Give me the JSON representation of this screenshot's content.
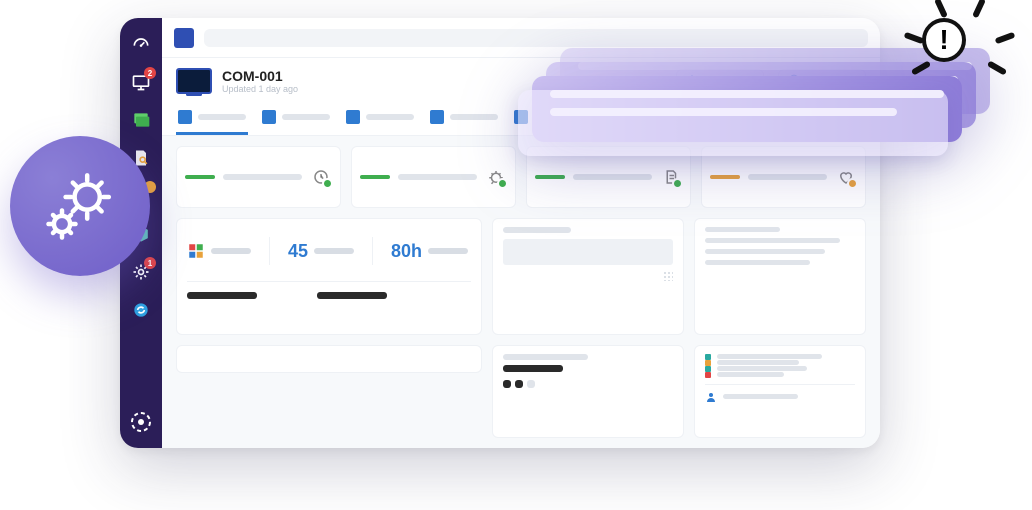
{
  "colors": {
    "accent": "#2f7bd1",
    "ok": "#3fae4f",
    "warn": "#e8a23b",
    "red": "#e24545",
    "purple": "#6f5ec8",
    "teal": "#2aa9a0"
  },
  "sidebar": {
    "items": [
      {
        "name": "dashboard",
        "icon": "gauge",
        "badge": null
      },
      {
        "name": "devices",
        "icon": "monitor",
        "badge": {
          "text": "2",
          "bg": "#e24545"
        }
      },
      {
        "name": "software",
        "icon": "stack",
        "badge": null
      },
      {
        "name": "reports",
        "icon": "doc-search",
        "badge": null
      },
      {
        "name": "database",
        "icon": "db",
        "badge": {
          "text": "",
          "bg": "#e8a23b"
        }
      },
      {
        "name": "packages",
        "icon": "box",
        "badge": null
      },
      {
        "name": "settings",
        "icon": "gear",
        "badge": {
          "text": "1",
          "bg": "#e24545"
        }
      },
      {
        "name": "sync",
        "icon": "refresh",
        "badge": null
      }
    ]
  },
  "device": {
    "id": "COM-001",
    "updated": "Updated 1 day ago"
  },
  "chips": [
    {
      "icon": "target"
    },
    {
      "icon": "map-pin"
    }
  ],
  "tabs": {
    "count": 5,
    "active": 0
  },
  "status_cards": [
    {
      "accent": "#3fae4f",
      "icon": "clock",
      "state": "ok"
    },
    {
      "accent": "#3fae4f",
      "icon": "bug",
      "state": "ok"
    },
    {
      "accent": "#3fae4f",
      "icon": "file",
      "state": "ok"
    },
    {
      "accent": "#e8a23b",
      "icon": "heart",
      "state": "warn"
    }
  ],
  "alert": {
    "count": 1
  },
  "metrics": {
    "os_icon": "windows",
    "left_value": "45",
    "right_value": "80h"
  },
  "bullets": [
    {
      "color": "#2aa9a0"
    },
    {
      "color": "#e8a23b"
    },
    {
      "color": "#2aa9a0"
    },
    {
      "color": "#e24545"
    }
  ],
  "notifications": {
    "count": 4
  }
}
